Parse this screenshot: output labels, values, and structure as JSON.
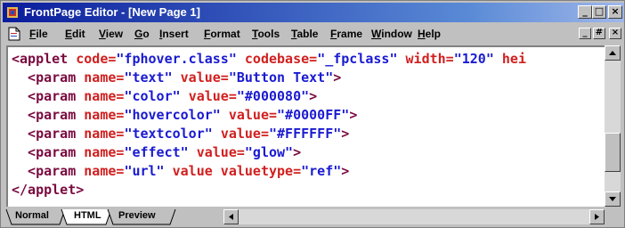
{
  "window": {
    "title": "FrontPage Editor - [New Page 1]",
    "caption_minimize": "_",
    "caption_maximize": "□",
    "caption_close": "×"
  },
  "menu": {
    "items": [
      "File",
      "Edit",
      "View",
      "Go",
      "Insert",
      "Format",
      "Tools",
      "Table",
      "Frame",
      "Window",
      "Help"
    ],
    "mdi_minimize": "_",
    "mdi_restore": "#",
    "mdi_close": "×"
  },
  "code": {
    "lines": [
      [
        {
          "t": "tag",
          "v": "<applet "
        },
        {
          "t": "attr",
          "v": "code="
        },
        {
          "t": "val",
          "v": "\"fphover.class\" "
        },
        {
          "t": "attr",
          "v": "codebase="
        },
        {
          "t": "val",
          "v": "\"_fpclass\" "
        },
        {
          "t": "attr",
          "v": "width="
        },
        {
          "t": "val",
          "v": "\"120\" "
        },
        {
          "t": "attr",
          "v": "hei"
        }
      ],
      [
        {
          "t": "tag",
          "v": "  <param "
        },
        {
          "t": "attr",
          "v": "name="
        },
        {
          "t": "val",
          "v": "\"text\" "
        },
        {
          "t": "attr",
          "v": "value="
        },
        {
          "t": "val",
          "v": "\"Button Text\""
        },
        {
          "t": "tag",
          "v": ">"
        }
      ],
      [
        {
          "t": "tag",
          "v": "  <param "
        },
        {
          "t": "attr",
          "v": "name="
        },
        {
          "t": "val",
          "v": "\"color\" "
        },
        {
          "t": "attr",
          "v": "value="
        },
        {
          "t": "val",
          "v": "\"#000080\""
        },
        {
          "t": "tag",
          "v": ">"
        }
      ],
      [
        {
          "t": "tag",
          "v": "  <param "
        },
        {
          "t": "attr",
          "v": "name="
        },
        {
          "t": "val",
          "v": "\"hovercolor\" "
        },
        {
          "t": "attr",
          "v": "value="
        },
        {
          "t": "val",
          "v": "\"#0000FF\""
        },
        {
          "t": "tag",
          "v": ">"
        }
      ],
      [
        {
          "t": "tag",
          "v": "  <param "
        },
        {
          "t": "attr",
          "v": "name="
        },
        {
          "t": "val",
          "v": "\"textcolor\" "
        },
        {
          "t": "attr",
          "v": "value="
        },
        {
          "t": "val",
          "v": "\"#FFFFFF\""
        },
        {
          "t": "tag",
          "v": ">"
        }
      ],
      [
        {
          "t": "tag",
          "v": "  <param "
        },
        {
          "t": "attr",
          "v": "name="
        },
        {
          "t": "val",
          "v": "\"effect\" "
        },
        {
          "t": "attr",
          "v": "value="
        },
        {
          "t": "val",
          "v": "\"glow\""
        },
        {
          "t": "tag",
          "v": ">"
        }
      ],
      [
        {
          "t": "tag",
          "v": "  <param "
        },
        {
          "t": "attr",
          "v": "name="
        },
        {
          "t": "val",
          "v": "\"url\" "
        },
        {
          "t": "attr",
          "v": "value valuetype="
        },
        {
          "t": "val",
          "v": "\"ref\""
        },
        {
          "t": "tag",
          "v": ">"
        }
      ],
      [
        {
          "t": "tag",
          "v": "</applet>"
        }
      ]
    ]
  },
  "tabs": {
    "items": [
      "Normal",
      "HTML",
      "Preview"
    ],
    "active": "HTML"
  },
  "colors": {
    "tag": "#7a0a3f",
    "attribute": "#d11f1f",
    "value": "#1a1ad1",
    "titlebar_start": "#0a1c9c"
  },
  "icons": {
    "app": "frontpage-app-icon",
    "document": "document-icon",
    "scroll_up": "arrow-up-icon",
    "scroll_down": "arrow-down-icon",
    "scroll_left": "arrow-left-icon",
    "scroll_right": "arrow-right-icon"
  }
}
